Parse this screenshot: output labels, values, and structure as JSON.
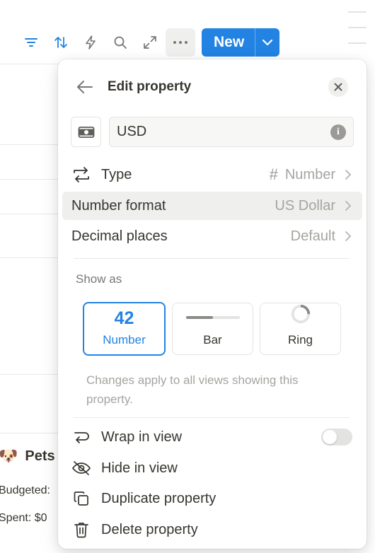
{
  "toolbar": {
    "icons": [
      "filter-icon",
      "sort-icon",
      "automation-icon",
      "search-icon",
      "expand-icon",
      "more-icon"
    ],
    "new_label": "New"
  },
  "background": {
    "pets_emoji": "🐶",
    "pets_title": "Pets",
    "budgeted_text": "Budgeted:",
    "spent_text": "Spent: $0"
  },
  "popover": {
    "title": "Edit property",
    "name_value": "USD",
    "rows": {
      "type": {
        "label": "Type",
        "value": "Number",
        "value_glyph": "#"
      },
      "number_format": {
        "label": "Number format",
        "value": "US Dollar"
      },
      "decimal_places": {
        "label": "Decimal places",
        "value": "Default"
      }
    },
    "show_as": {
      "label": "Show as",
      "options": [
        {
          "big": "42",
          "label": "Number",
          "selected": true
        },
        {
          "label": "Bar",
          "bar_fraction": 0.5
        },
        {
          "label": "Ring",
          "ring_fraction": 0.25
        }
      ]
    },
    "helper_text": "Changes apply to all views showing this property.",
    "actions": {
      "wrap": {
        "label": "Wrap in view",
        "toggle_on": false
      },
      "hide": {
        "label": "Hide in view"
      },
      "duplicate": {
        "label": "Duplicate property"
      },
      "delete": {
        "label": "Delete property"
      }
    }
  },
  "colors": {
    "accent": "#2383e2",
    "text": "#37352f",
    "muted": "#a5a4a0"
  }
}
